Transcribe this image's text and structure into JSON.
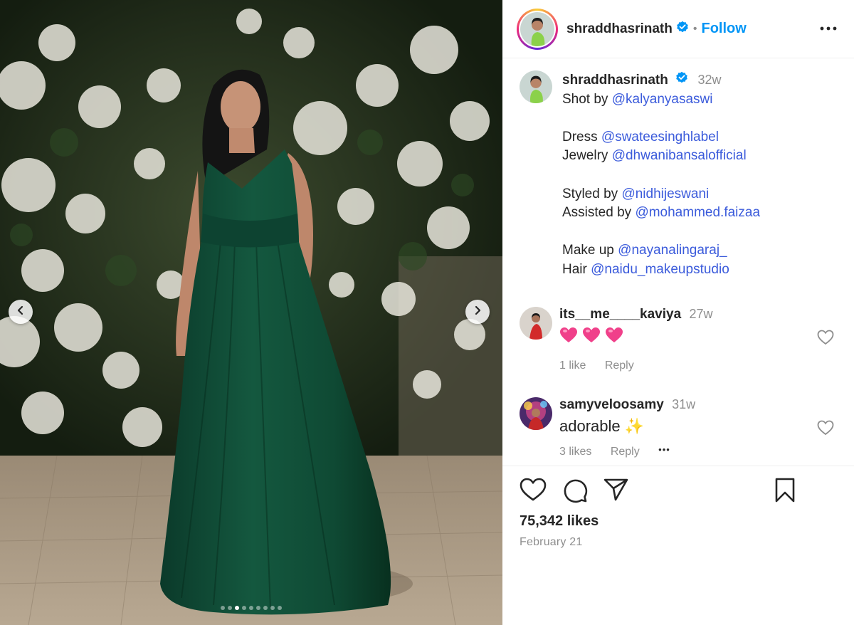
{
  "post": {
    "image_alt": "Woman in a long green gown standing in front of a wall of white bougainvillea flowers",
    "carousel": {
      "slides": 9,
      "active": 2
    }
  },
  "header": {
    "username": "shraddhasrinath",
    "separator": "•",
    "follow_label": "Follow"
  },
  "caption": {
    "username": "shraddhasrinath",
    "time": "32w",
    "lines": [
      {
        "prefix": "Shot by ",
        "mention": "@kalyanyasaswi"
      },
      null,
      {
        "prefix": "Dress ",
        "mention": "@swateesinghlabel"
      },
      {
        "prefix": "Jewelry ",
        "mention": "@dhwanibansalofficial"
      },
      null,
      {
        "prefix": "Styled by ",
        "mention": "@nidhijeswani"
      },
      {
        "prefix": "Assisted by ",
        "mention": "@mohammed.faizaa"
      },
      null,
      {
        "prefix": "Make up ",
        "mention": "@nayanalingaraj_"
      },
      {
        "prefix": "Hair ",
        "mention": "@naidu_makeupstudio"
      }
    ]
  },
  "comments": [
    {
      "username": "its__me____kaviya",
      "time": "27w",
      "text": "💗💗💗",
      "likes": "1 like",
      "reply": "Reply"
    },
    {
      "username": "samyveloosamy",
      "time": "31w",
      "text": "adorable ✨",
      "likes": "3 likes",
      "reply": "Reply",
      "more": "•••"
    }
  ],
  "footer": {
    "likes": "75,342 likes",
    "date": "February 21"
  },
  "colors": {
    "accent": "#0095f6",
    "mention": "#3b5bdb",
    "muted": "#8e8e8e",
    "verified": "#0095f6"
  },
  "icons": {
    "prev": "chevron-left-icon",
    "next": "chevron-right-icon",
    "more": "more-horizontal-icon",
    "like": "heart-icon",
    "comment": "comment-icon",
    "share": "send-icon",
    "save": "bookmark-icon"
  }
}
